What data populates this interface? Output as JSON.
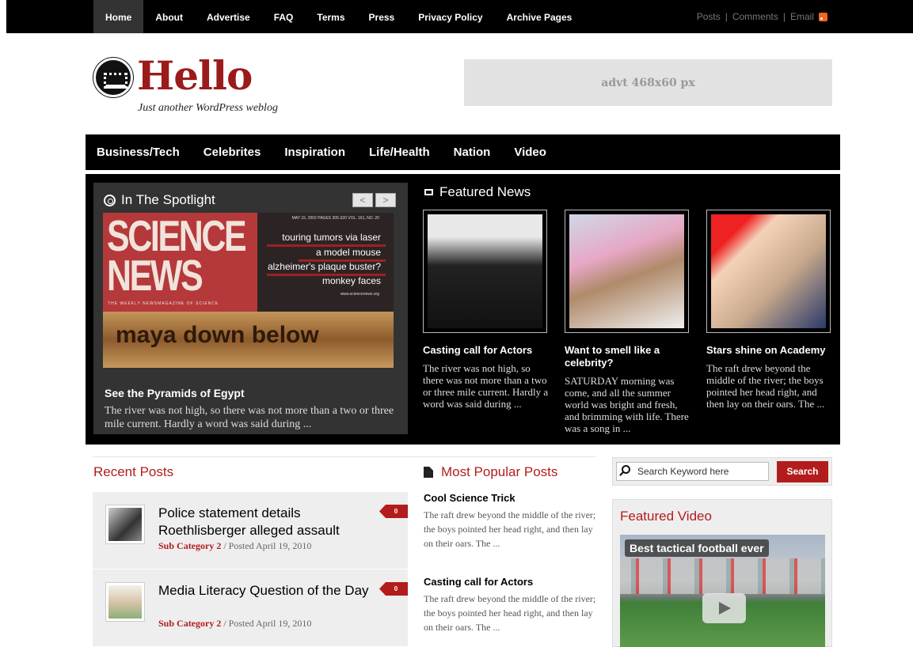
{
  "topnav": {
    "items": [
      "Home",
      "About",
      "Advertise",
      "FAQ",
      "Terms",
      "Press",
      "Privacy Policy",
      "Archive Pages"
    ],
    "links": [
      "Posts",
      "Comments",
      "Email"
    ]
  },
  "header": {
    "title": "Hello",
    "tagline": "Just another WordPress weblog",
    "ad": "advt 468x60 px"
  },
  "catnav": [
    "Business/Tech",
    "Celebrites",
    "Inspiration",
    "Life/Health",
    "Nation",
    "Video"
  ],
  "spotlight": {
    "heading": "In The Spotlight",
    "prev": "<",
    "next": ">",
    "cover": {
      "masthead_1": "SCIENCE",
      "masthead_2": "NEWS",
      "issue": "MAY 15, 2002   PAGES 305-320   VOL. 161, NO. 20",
      "weekly": "THE WEEKLY NEWSMAGAZINE OF SCIENCE",
      "headlines": [
        "touring tumors via laser",
        "a model mouse",
        "alzheimer's plaque buster?",
        "monkey faces"
      ],
      "url": "www.sciencenews.org",
      "feature": "maya down below"
    },
    "title": "See the Pyramids of Egypt",
    "excerpt": "The river was not high, so there was not more than a two or three mile current. Hardly a word was said during ..."
  },
  "featured": {
    "heading": "Featured News",
    "items": [
      {
        "title": "Casting call for Actors",
        "excerpt": "The river was not high, so there was not more than a two or three mile current. Hardly a word was said during ..."
      },
      {
        "title": "Want to smell like a celebrity?",
        "excerpt": "SATURDAY morning was come, and all the summer world was bright and fresh, and brimming with life. There was a song in ..."
      },
      {
        "title": "Stars shine on Academy",
        "excerpt": "The raft drew beyond the middle of the river; the boys pointed her head right, and then lay on their oars. The ..."
      }
    ]
  },
  "recent": {
    "heading": "Recent Posts",
    "items": [
      {
        "title": "Police statement details Roethlisberger alleged assault",
        "category": "Sub Category 2",
        "meta": " / Posted April 19, 2010",
        "count": "0"
      },
      {
        "title": "Media Literacy Question of the Day",
        "category": "Sub Category 2",
        "meta": " / Posted April 19, 2010",
        "count": "0"
      }
    ]
  },
  "popular": {
    "heading": "Most Popular Posts",
    "items": [
      {
        "title": "Cool Science Trick",
        "excerpt": "The raft drew beyond the middle of the river; the boys pointed her head right, and then lay on their oars. The ..."
      },
      {
        "title": "Casting call for Actors",
        "excerpt": "The raft drew beyond the middle of the river; the boys pointed her head right, and then lay on their oars. The ..."
      }
    ]
  },
  "search": {
    "placeholder": "Search Keyword here",
    "button": "Search"
  },
  "video": {
    "heading": "Featured Video",
    "title": "Best tactical football ever"
  }
}
